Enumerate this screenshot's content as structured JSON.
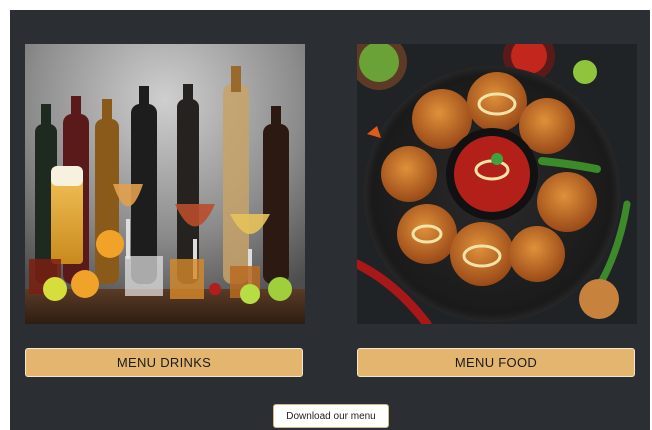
{
  "cards": {
    "drinks": {
      "button_label": "MENU DRINKS",
      "image_icon": "drinks-photo"
    },
    "food": {
      "button_label": "MENU FOOD",
      "image_icon": "food-photo"
    }
  },
  "download": {
    "label": "Download our menu"
  },
  "colors": {
    "panel_bg": "#2b2e33",
    "button_bg": "#e3b56f",
    "button_border": "#f3e6cf",
    "download_border": "#d9b77a"
  }
}
